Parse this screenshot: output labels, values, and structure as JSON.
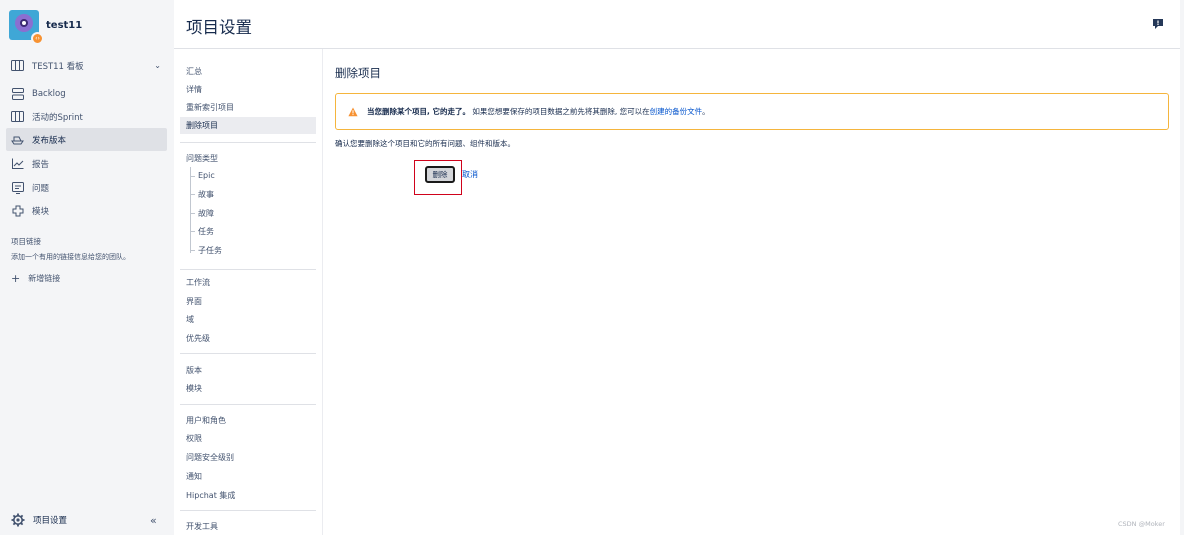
{
  "project": {
    "name": "test11"
  },
  "sidebar": {
    "items": [
      {
        "label": "TEST11 看板",
        "icon": "board-icon"
      },
      {
        "label": "Backlog",
        "icon": "backlog-icon"
      },
      {
        "label": "活动的Sprint",
        "icon": "sprint-icon"
      },
      {
        "label": "发布版本",
        "icon": "ship-icon"
      },
      {
        "label": "报告",
        "icon": "chart-icon"
      },
      {
        "label": "问题",
        "icon": "issues-icon"
      },
      {
        "label": "模块",
        "icon": "component-icon"
      }
    ],
    "links_heading": "项目链接",
    "links_desc": "添加一个有用的链接信息给您的团队。",
    "add_link": "新增链接",
    "settings_label": "项目设置",
    "collapse_icon": "«"
  },
  "header": {
    "title": "项目设置"
  },
  "settings_nav": {
    "group1": [
      "汇总",
      "详情",
      "重新索引项目",
      "删除项目"
    ],
    "issue_types_heading": "问题类型",
    "issue_types": [
      "Epic",
      "故事",
      "故障",
      "任务",
      "子任务"
    ],
    "group3": [
      "工作流",
      "界面",
      "域",
      "优先级"
    ],
    "group4": [
      "版本",
      "模块"
    ],
    "group5": [
      "用户和角色",
      "权限",
      "问题安全级别",
      "通知",
      "Hipchat 集成"
    ],
    "group6": [
      "开发工具"
    ]
  },
  "content": {
    "section_title": "删除项目",
    "warning_bold": "当您删除某个项目, 它的走了。",
    "warning_text": "如果您想要保存的项目数据之前先将其删除, 您可以在",
    "warning_link": "创建的备份文件",
    "warning_end": "。",
    "confirm_text": "确认您要删除这个项目和它的所有问题、组件和版本。",
    "delete_label": "删除",
    "cancel_label": "取消"
  },
  "watermark": "CSDN @Moker",
  "colors": {
    "sidebar_bg": "#f4f5f7",
    "warning_border": "#f5b53d",
    "link": "#0052cc",
    "highlight": "#d0021b"
  }
}
